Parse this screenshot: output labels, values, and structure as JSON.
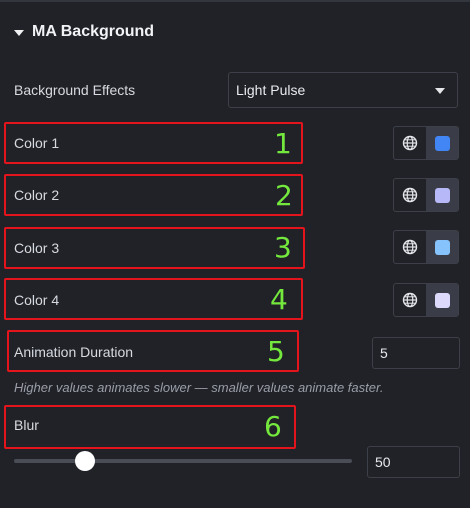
{
  "section": {
    "title": "MA Background"
  },
  "background_effects": {
    "label": "Background Effects",
    "selected": "Light Pulse"
  },
  "colors": [
    {
      "label": "Color 1",
      "number": "1",
      "swatch": "#4285f4"
    },
    {
      "label": "Color 2",
      "number": "2",
      "swatch": "#b7b8f8"
    },
    {
      "label": "Color 3",
      "number": "3",
      "swatch": "#86c2fb"
    },
    {
      "label": "Color 4",
      "number": "4",
      "swatch": "#ddd9fb"
    }
  ],
  "animation_duration": {
    "label": "Animation Duration",
    "number": "5",
    "value": "5",
    "help": "Higher values animates slower — smaller values animate faster."
  },
  "blur": {
    "label": "Blur",
    "number": "6",
    "value": "50",
    "slider_fraction": 0.21
  },
  "annotation_color": "#e3141b",
  "number_color": "#74e83c"
}
